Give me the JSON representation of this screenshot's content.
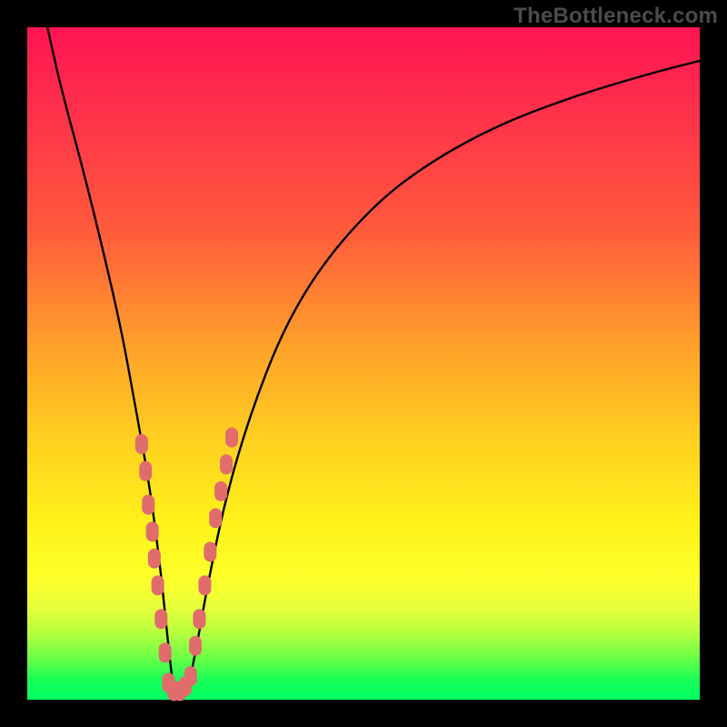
{
  "watermark": {
    "text": "TheBottleneck.com"
  },
  "chart_data": {
    "type": "line",
    "title": "",
    "xlabel": "",
    "ylabel": "",
    "xlim": [
      0,
      100
    ],
    "ylim": [
      0,
      100
    ],
    "grid": false,
    "legend": false,
    "background_gradient": {
      "stops": [
        {
          "pos": 0,
          "color": "#ff1453"
        },
        {
          "pos": 30,
          "color": "#ff5a3c"
        },
        {
          "pos": 60,
          "color": "#ffd21f"
        },
        {
          "pos": 82,
          "color": "#fdff2b"
        },
        {
          "pos": 100,
          "color": "#00ff66"
        }
      ]
    },
    "series": [
      {
        "name": "bottleneck-curve",
        "color": "#000000",
        "x": [
          3,
          5,
          8,
          11,
          14,
          16,
          18,
          19.5,
          20.6,
          21.3,
          22,
          23,
          24,
          25.2,
          27,
          29.5,
          33,
          38,
          44,
          52,
          60,
          70,
          82,
          94,
          100
        ],
        "y": [
          100,
          91,
          80,
          68,
          55,
          44,
          33,
          22,
          12,
          5,
          0,
          0,
          2,
          8,
          18,
          30,
          42,
          55,
          65,
          74,
          80,
          85.5,
          90,
          93.5,
          95
        ]
      }
    ],
    "markers": [
      {
        "name": "left-cluster",
        "color": "#e06c6c",
        "points": [
          {
            "x": 17.0,
            "y": 38
          },
          {
            "x": 17.6,
            "y": 34
          },
          {
            "x": 18.0,
            "y": 29
          },
          {
            "x": 18.6,
            "y": 25
          },
          {
            "x": 18.9,
            "y": 21
          },
          {
            "x": 19.4,
            "y": 17
          },
          {
            "x": 19.9,
            "y": 12
          },
          {
            "x": 20.5,
            "y": 7
          }
        ]
      },
      {
        "name": "bottom-cluster",
        "color": "#e06c6c",
        "points": [
          {
            "x": 21.0,
            "y": 2.5
          },
          {
            "x": 21.8,
            "y": 1.3
          },
          {
            "x": 22.7,
            "y": 1.3
          },
          {
            "x": 23.5,
            "y": 2.0
          },
          {
            "x": 24.3,
            "y": 3.5
          }
        ]
      },
      {
        "name": "right-cluster",
        "color": "#e06c6c",
        "points": [
          {
            "x": 25.0,
            "y": 8
          },
          {
            "x": 25.6,
            "y": 12
          },
          {
            "x": 26.4,
            "y": 17
          },
          {
            "x": 27.2,
            "y": 22
          },
          {
            "x": 28.0,
            "y": 27
          },
          {
            "x": 28.8,
            "y": 31
          },
          {
            "x": 29.6,
            "y": 35
          },
          {
            "x": 30.4,
            "y": 39
          }
        ]
      }
    ]
  }
}
